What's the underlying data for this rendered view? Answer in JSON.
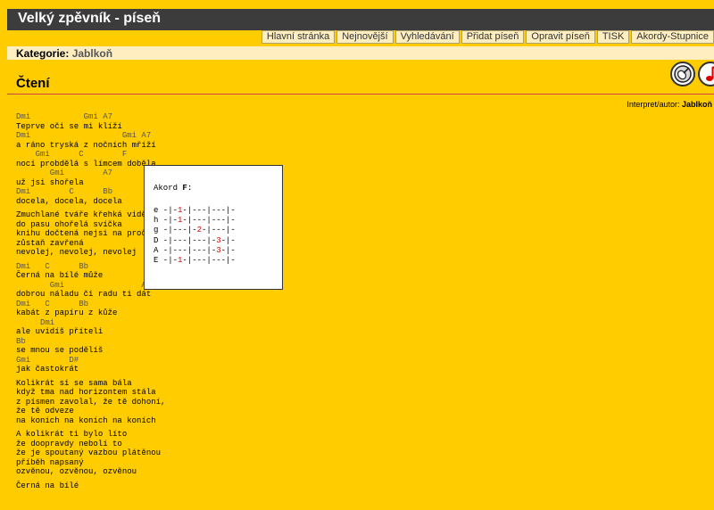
{
  "site": {
    "title": "Velký zpěvník - píseň"
  },
  "nav": [
    "Hlavní stránka",
    "Nejnovější",
    "Vyhledávání",
    "Přidat píseň",
    "Opravit píseň",
    "TISK",
    "Akordy-Stupnice"
  ],
  "category": {
    "label": "Kategorie:",
    "value": "Jablkoň"
  },
  "song": {
    "title": "Čtení",
    "author_label": "Interpret/autor:",
    "author": "Jablkoň"
  },
  "icons": {
    "guitar": "guitar-icon",
    "note": "music-note-icon"
  },
  "lyrics": [
    {
      "t": "c",
      "v": "Dmi           Gmi A7"
    },
    {
      "t": "l",
      "v": "Teprve oči se mi klíží"
    },
    {
      "t": "c",
      "v": "Dmi                   Gmi A7"
    },
    {
      "t": "l",
      "v": "a ráno tryská z nočních mříží"
    },
    {
      "t": "c",
      "v": "    Gmi      C        F"
    },
    {
      "t": "l",
      "v": "noci probdělá s límcem doběla"
    },
    {
      "t": "c",
      "v": "       Gmi        A7"
    },
    {
      "t": "l",
      "v": "už jsi shořela"
    },
    {
      "t": "c",
      "v": "Dmi        C      Bb"
    },
    {
      "t": "l",
      "v": "docela, docela, docela"
    },
    {
      "t": "b",
      "v": ""
    },
    {
      "t": "l",
      "v": "Zmuchlané tváře křehká vidění"
    },
    {
      "t": "l",
      "v": "do pasu ohořelá svíčka"
    },
    {
      "t": "l",
      "v": "knihu dočtená nejsi na proč"
    },
    {
      "t": "l",
      "v": "zůstaň zavřená"
    },
    {
      "t": "l",
      "v": "nevolej, nevolej, nevolej"
    },
    {
      "t": "b",
      "v": ""
    },
    {
      "t": "c",
      "v": "Dmi   C      Bb"
    },
    {
      "t": "l",
      "v": "Černá na bílé může"
    },
    {
      "t": "c",
      "v": "       Gmi                A7"
    },
    {
      "t": "l",
      "v": "dobrou náladu či radu ti dát"
    },
    {
      "t": "c",
      "v": "Dmi   C      Bb"
    },
    {
      "t": "l",
      "v": "kabát z papíru z kůže"
    },
    {
      "t": "c",
      "v": "     Dmi"
    },
    {
      "t": "l",
      "v": "ale uvidíš příteli"
    },
    {
      "t": "c",
      "v": "Bb"
    },
    {
      "t": "l",
      "v": "se mnou se podělíš"
    },
    {
      "t": "c",
      "v": "Gmi        D#"
    },
    {
      "t": "l",
      "v": "jak častokrát"
    },
    {
      "t": "b",
      "v": ""
    },
    {
      "t": "l",
      "v": "Kolikrát si se sama bála"
    },
    {
      "t": "l",
      "v": "když tma nad horizontem stála"
    },
    {
      "t": "l",
      "v": "z písmen zavolal, že tě dohoní,"
    },
    {
      "t": "l",
      "v": "že tě odveze"
    },
    {
      "t": "l",
      "v": "na koních na koních na koních"
    },
    {
      "t": "b",
      "v": ""
    },
    {
      "t": "l",
      "v": "A kolikrát ti bylo líto"
    },
    {
      "t": "l",
      "v": "že doopravdy nebolí to"
    },
    {
      "t": "l",
      "v": "že je spoutaný vazbou plátěnou"
    },
    {
      "t": "l",
      "v": "příběh napsaný"
    },
    {
      "t": "l",
      "v": "ozvěnou, ozvěnou, ozvěnou"
    },
    {
      "t": "b",
      "v": ""
    },
    {
      "t": "l",
      "v": "Černá na bílé"
    }
  ],
  "chord_popup": {
    "title_prefix": "Akord",
    "chord": "F:",
    "strings": [
      {
        "name": "e",
        "pre": " -|-",
        "f": "1",
        "post": "-|---|---|-"
      },
      {
        "name": "h",
        "pre": " -|-",
        "f": "1",
        "post": "-|---|---|-"
      },
      {
        "name": "g",
        "pre": " -|---|-",
        "f": "2",
        "post": "-|---|-"
      },
      {
        "name": "D",
        "pre": " -|---|---|-",
        "f": "3",
        "post": "-|-"
      },
      {
        "name": "A",
        "pre": " -|---|---|-",
        "f": "3",
        "post": "-|-"
      },
      {
        "name": "E",
        "pre": " -|-",
        "f": "1",
        "post": "-|---|---|-"
      }
    ]
  }
}
